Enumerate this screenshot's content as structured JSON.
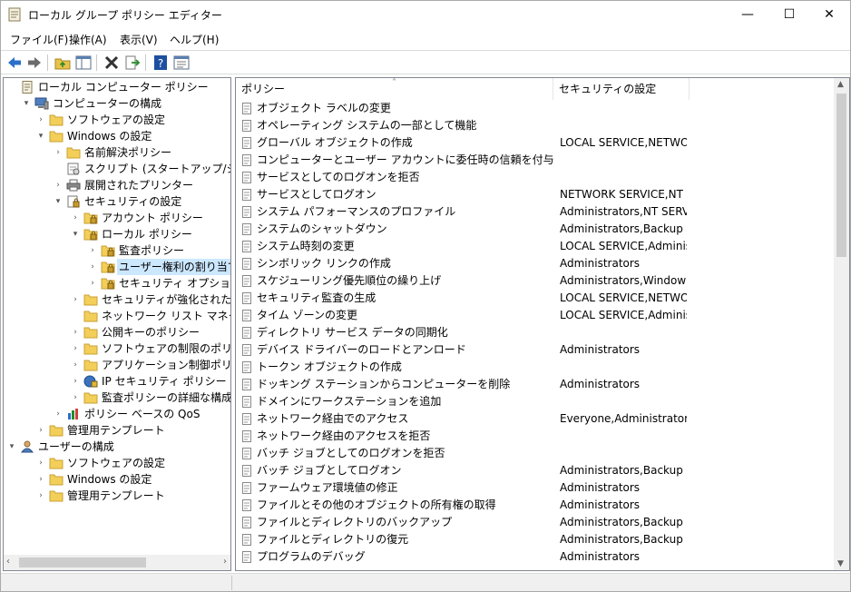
{
  "window": {
    "title": "ローカル グループ ポリシー エディター",
    "minimize": "—",
    "maximize": "☐",
    "close": "✕"
  },
  "menu": [
    "ファイル(F)",
    "操作(A)",
    "表示(V)",
    "ヘルプ(H)"
  ],
  "toolbar": {
    "buttons": [
      "back-icon",
      "forward-icon",
      "up-folder-icon",
      "show-hide-tree-icon",
      "delete-icon",
      "export-icon",
      "help-icon",
      "properties-icon"
    ],
    "colors": {
      "back": "#2a6fc9",
      "forward": "#6b6b6b",
      "delete": "#333333",
      "help": "#1c4fa0"
    }
  },
  "tree": [
    {
      "label": "ローカル コンピューター ポリシー",
      "expander": "",
      "icon": "policy-doc-icon"
    },
    {
      "label": "コンピューターの構成",
      "expander": "▾",
      "icon": "computer-icon"
    },
    {
      "label": "ソフトウェアの設定",
      "expander": "›",
      "icon": "folder-icon"
    },
    {
      "label": "Windows の設定",
      "expander": "▾",
      "icon": "folder-icon"
    },
    {
      "label": "名前解決ポリシー",
      "expander": "›",
      "icon": "folder-icon"
    },
    {
      "label": "スクリプト (スタートアップ/シャットダウ",
      "expander": "",
      "icon": "script-icon"
    },
    {
      "label": "展開されたプリンター",
      "expander": "›",
      "icon": "printer-icon"
    },
    {
      "label": "セキュリティの設定",
      "expander": "▾",
      "icon": "security-settings-icon"
    },
    {
      "label": "アカウント ポリシー",
      "expander": "›",
      "icon": "locked-folder-icon"
    },
    {
      "label": "ローカル ポリシー",
      "expander": "▾",
      "icon": "locked-folder-icon"
    },
    {
      "label": "監査ポリシー",
      "expander": "›",
      "icon": "locked-folder-icon"
    },
    {
      "label": "ユーザー権利の割り当て",
      "expander": "›",
      "icon": "locked-folder-icon",
      "selected": true
    },
    {
      "label": "セキュリティ オプション",
      "expander": "›",
      "icon": "locked-folder-icon"
    },
    {
      "label": "セキュリティが強化された Windo",
      "expander": "›",
      "icon": "folder-icon"
    },
    {
      "label": "ネットワーク リスト マネージャー ポ",
      "expander": "",
      "icon": "folder-icon"
    },
    {
      "label": "公開キーのポリシー",
      "expander": "›",
      "icon": "folder-icon"
    },
    {
      "label": "ソフトウェアの制限のポリシー",
      "expander": "›",
      "icon": "folder-icon"
    },
    {
      "label": "アプリケーション制御ポリシー",
      "expander": "›",
      "icon": "folder-icon"
    },
    {
      "label": "IP セキュリティ ポリシー (ローカル",
      "expander": "›",
      "icon": "ip-security-icon"
    },
    {
      "label": "監査ポリシーの詳細な構成",
      "expander": "›",
      "icon": "folder-icon"
    },
    {
      "label": "ポリシー ベースの QoS",
      "expander": "›",
      "icon": "qos-chart-icon"
    },
    {
      "label": "管理用テンプレート",
      "expander": "›",
      "icon": "folder-icon"
    },
    {
      "label": "ユーザーの構成",
      "expander": "▾",
      "icon": "user-icon"
    },
    {
      "label": "ソフトウェアの設定",
      "expander": "›",
      "icon": "folder-icon"
    },
    {
      "label": "Windows の設定",
      "expander": "›",
      "icon": "folder-icon"
    },
    {
      "label": "管理用テンプレート",
      "expander": "›",
      "icon": "folder-icon"
    }
  ],
  "list": {
    "headers": {
      "policy": "ポリシー",
      "setting": "セキュリティの設定",
      "sort_arrow": "˄"
    },
    "rows": [
      {
        "policy": "オブジェクト ラベルの変更",
        "setting": ""
      },
      {
        "policy": "オペレーティング システムの一部として機能",
        "setting": ""
      },
      {
        "policy": "グローバル オブジェクトの作成",
        "setting": "LOCAL SERVICE,NETWO..."
      },
      {
        "policy": "コンピューターとユーザー アカウントに委任時の信頼を付与",
        "setting": ""
      },
      {
        "policy": "サービスとしてのログオンを拒否",
        "setting": ""
      },
      {
        "policy": "サービスとしてログオン",
        "setting": "NETWORK SERVICE,NT S..."
      },
      {
        "policy": "システム パフォーマンスのプロファイル",
        "setting": "Administrators,NT SERVI..."
      },
      {
        "policy": "システムのシャットダウン",
        "setting": "Administrators,Backup ..."
      },
      {
        "policy": "システム時刻の変更",
        "setting": "LOCAL SERVICE,Adminis..."
      },
      {
        "policy": "シンボリック リンクの作成",
        "setting": "Administrators"
      },
      {
        "policy": "スケジューリング優先順位の繰り上げ",
        "setting": "Administrators,Window ..."
      },
      {
        "policy": "セキュリティ監査の生成",
        "setting": "LOCAL SERVICE,NETWO..."
      },
      {
        "policy": "タイム ゾーンの変更",
        "setting": "LOCAL SERVICE,Adminis..."
      },
      {
        "policy": "ディレクトリ サービス データの同期化",
        "setting": ""
      },
      {
        "policy": "デバイス ドライバーのロードとアンロード",
        "setting": "Administrators"
      },
      {
        "policy": "トークン オブジェクトの作成",
        "setting": ""
      },
      {
        "policy": "ドッキング ステーションからコンピューターを削除",
        "setting": "Administrators"
      },
      {
        "policy": "ドメインにワークステーションを追加",
        "setting": ""
      },
      {
        "policy": "ネットワーク経由でのアクセス",
        "setting": "Everyone,Administrators..."
      },
      {
        "policy": "ネットワーク経由のアクセスを拒否",
        "setting": ""
      },
      {
        "policy": "バッチ ジョブとしてのログオンを拒否",
        "setting": ""
      },
      {
        "policy": "バッチ ジョブとしてログオン",
        "setting": "Administrators,Backup ..."
      },
      {
        "policy": "ファームウェア環境値の修正",
        "setting": "Administrators"
      },
      {
        "policy": "ファイルとその他のオブジェクトの所有権の取得",
        "setting": "Administrators"
      },
      {
        "policy": "ファイルとディレクトリのバックアップ",
        "setting": "Administrators,Backup ..."
      },
      {
        "policy": "ファイルとディレクトリの復元",
        "setting": "Administrators,Backup ..."
      },
      {
        "policy": "プログラムのデバッグ",
        "setting": "Administrators"
      }
    ]
  },
  "scrollbars": {
    "left": "‹",
    "right": "›",
    "up": "▲",
    "down": "▼"
  }
}
